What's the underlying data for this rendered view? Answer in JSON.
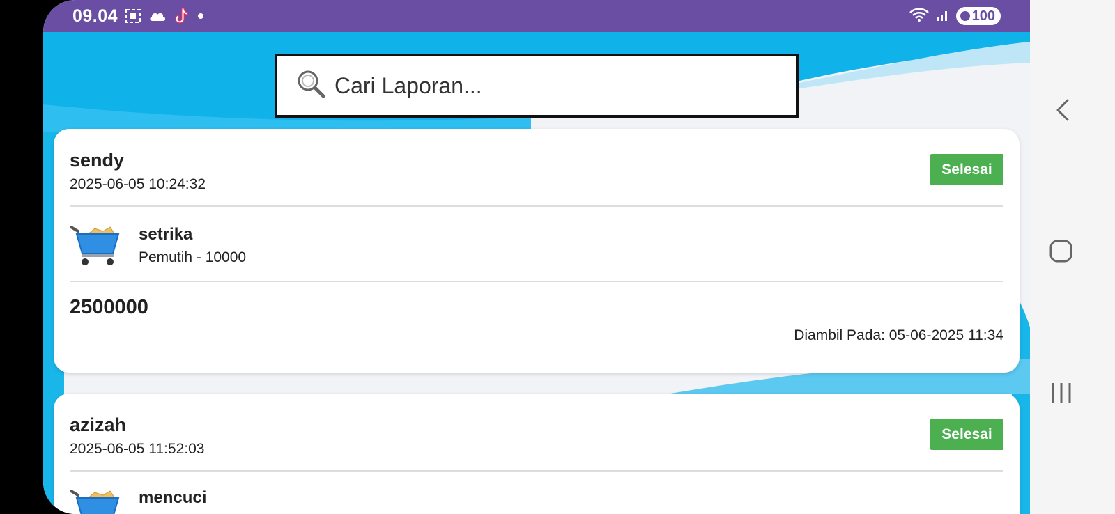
{
  "status_bar": {
    "time": "09.04",
    "battery": "100",
    "icons": [
      "screenshot-icon",
      "cloud-icon",
      "tiktok-icon",
      "dot-icon",
      "wifi-icon",
      "signal-icon"
    ]
  },
  "search": {
    "placeholder": "Cari Laporan..."
  },
  "reports": [
    {
      "name": "sendy",
      "date": "2025-06-05 10:24:32",
      "status": "Selesai",
      "service": "setrika",
      "detail": "Pemutih - 10000",
      "total": "2500000",
      "taken_at": "Diambil Pada: 05-06-2025 11:34"
    },
    {
      "name": "azizah",
      "date": "2025-06-05 11:52:03",
      "status": "Selesai",
      "service": "mencuci"
    }
  ],
  "colors": {
    "status_bar": "#6a4ea3",
    "status_done": "#4caf50",
    "wave": "#19b6ea"
  },
  "nav": {
    "icons": [
      "back-icon",
      "home-icon",
      "recents-icon"
    ]
  }
}
